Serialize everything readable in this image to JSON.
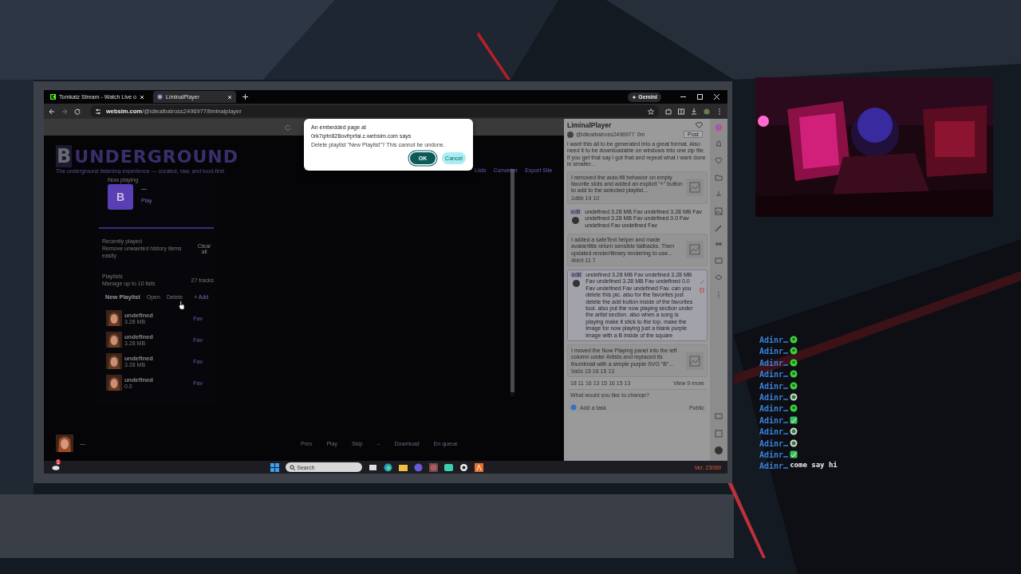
{
  "browser": {
    "tabs": [
      {
        "title": "Tomkatz Stream - Watch Live o",
        "selected": false
      },
      {
        "title": "LiminalPlayer",
        "selected": true
      }
    ],
    "address": "websim.com/@idlealbatross2496977/liminalplayer",
    "gemini_button": "Gemini"
  },
  "dialog": {
    "heading_lines": [
      "An embedded page at",
      "0rk7qrtn828ovfrprfai.c.websim.com says"
    ],
    "message": "Delete playlist \"New Playlist\"? This cannot be undone.",
    "buttons": [
      {
        "label": "OK",
        "kind": "primary"
      },
      {
        "label": "Cancel",
        "kind": "secondary"
      }
    ]
  },
  "app": {
    "logo_letter": "B",
    "logo_word": "UNDERGROUND",
    "tagline": "The underground listening experience — curated, raw, and loud-first",
    "nav": [
      "Lists",
      "Converter",
      "Export Site"
    ],
    "now_playing": {
      "label": "Now playing",
      "art_letter": "B",
      "title": "—",
      "play": "Play"
    },
    "recently_played": {
      "title": "Recently played",
      "subtitle": "Remove unwanted history items easily",
      "button": "Clear all"
    },
    "playlists": {
      "title": "Playlists",
      "subtitle": "Manage up to 10 lists",
      "count": "27 tracks",
      "name": "New Playlist",
      "actions": [
        "Open",
        "Delete"
      ],
      "add": "+ Add",
      "tracks": [
        {
          "title": "undefined",
          "size": "3.28 MB",
          "fav": "Fav"
        },
        {
          "title": "undefined",
          "size": "3.28 MB",
          "fav": "Fav"
        },
        {
          "title": "undefined",
          "size": "3.28 MB",
          "fav": "Fav"
        },
        {
          "title": "undefined",
          "size": "0.0",
          "fav": "Fav"
        }
      ]
    },
    "player_bar": {
      "title": "—",
      "controls": [
        "Prev",
        "Play",
        "Skip",
        "–",
        "Download",
        "En queue"
      ]
    }
  },
  "websim": {
    "title": "LiminalPlayer",
    "user": "@idlealbatross2496977",
    "time": "0m",
    "post_button": "Post",
    "prompt": "i want this all to be generated into a great format. Also need it to be downloadable on windows into one zip file. if you get that say i got that and repeat what i want done in smaller...",
    "messages": [
      {
        "kind": "reply",
        "text": "I removed the auto-fill behavior on empty favorite slots and added an explicit \"+\" button to add to the selected playlist...",
        "meta": "1d6b 19 10"
      },
      {
        "kind": "prompt",
        "tag": "edit",
        "text": "undefined 3.28 MB Fav undefined 3.28 MB Fav undefined 3.28 MB Fav undefined 0.0 Fav undefined Fav undefined Fav",
        "highlighted": false
      },
      {
        "kind": "reply",
        "text": "I added a safeText helper and made avatar/title return sensible fallbacks. Then updated render/library rendering to use...",
        "meta": "4bb9 11 7"
      },
      {
        "kind": "prompt",
        "tag": "edit",
        "text": "undefined 3.28 MB Fav undefined 3.28 MB Fav undefined 3.28 MB Fav undefined 0.0 Fav undefined Fav undefined Fav. can you delete this pic. also for the favorites just delete the add button inside of the favorites tool. also put the now playing section under the artist section. also when a song is playing make it stick to the top. make the image for now playing just a blank purple image with a B inside of the square",
        "highlighted": true
      },
      {
        "kind": "reply",
        "text": "I moved the Now Playing panel into the left column under Artists and replaced its thumbnail with a simple purple SVG \"B\"...",
        "meta": "9a0c 15 16 15 13"
      }
    ],
    "pagination": "18 11 16 13 15 16 15 13",
    "more_link": "View 9 more",
    "input_placeholder": "What would you like to change?",
    "attach_label": "Add a task",
    "visibility": "Public"
  },
  "taskbar": {
    "search_placeholder": "Search",
    "notification_count": "1"
  },
  "version": "Ver. 23069",
  "chat": [
    {
      "user": "Adinr…",
      "kind": "blob"
    },
    {
      "user": "Adinr…",
      "kind": "blob"
    },
    {
      "user": "Adinr…",
      "kind": "blob"
    },
    {
      "user": "Adinr…",
      "kind": "blob"
    },
    {
      "user": "Adinr…",
      "kind": "blob"
    },
    {
      "user": "Adinr…",
      "kind": "ball"
    },
    {
      "user": "Adinr…",
      "kind": "blob"
    },
    {
      "user": "Adinr…",
      "kind": "box"
    },
    {
      "user": "Adinr…",
      "kind": "ball"
    },
    {
      "user": "Adinr…",
      "kind": "ball"
    },
    {
      "user": "Adinr…",
      "kind": "box"
    },
    {
      "user": "Adinr…",
      "kind": "text",
      "text": "come say hi"
    }
  ]
}
